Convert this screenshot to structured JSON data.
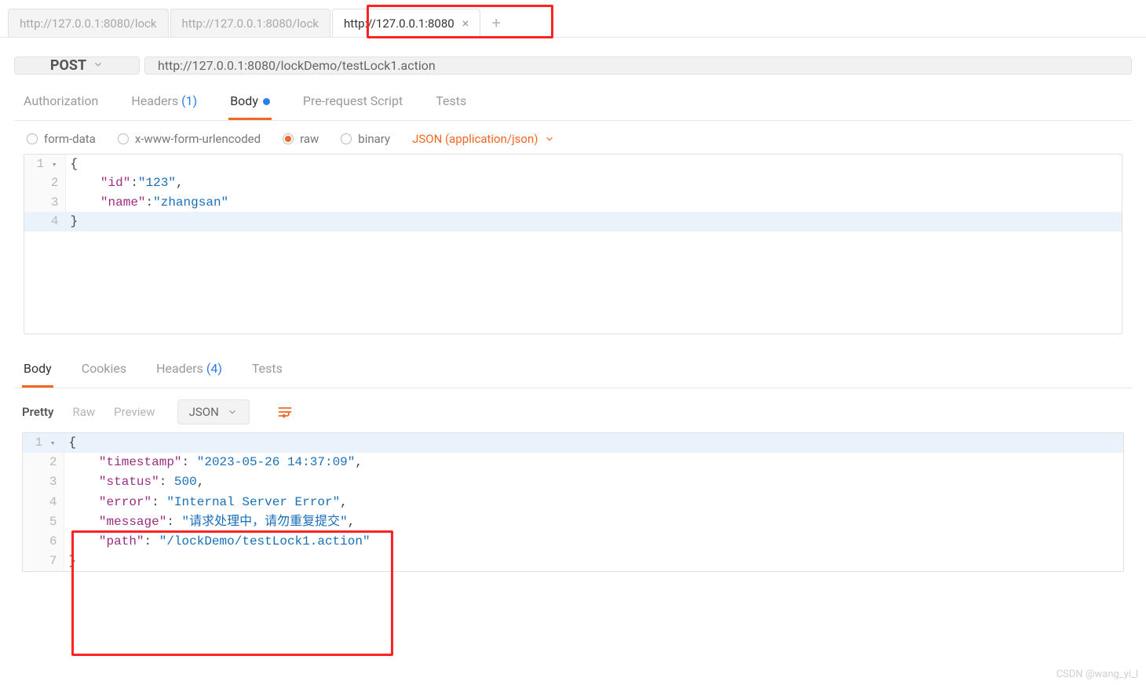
{
  "tabs": {
    "items": [
      {
        "label": "http://127.0.0.1:8080/lock"
      },
      {
        "label": "http://127.0.0.1:8080/lock"
      },
      {
        "label": "http://127.0.0.1:8080"
      }
    ]
  },
  "request": {
    "method": "POST",
    "url": "http://127.0.0.1:8080/lockDemo/testLock1.action"
  },
  "req_subtabs": {
    "authorization": "Authorization",
    "headers": "Headers",
    "headers_count": "(1)",
    "body": "Body",
    "prerequest": "Pre-request Script",
    "tests": "Tests"
  },
  "body_types": {
    "form_data": "form-data",
    "urlencoded": "x-www-form-urlencoded",
    "raw": "raw",
    "binary": "binary",
    "content_type": "JSON (application/json)"
  },
  "request_body": {
    "id_key": "\"id\"",
    "id_val": "\"123\"",
    "name_key": "\"name\"",
    "name_val": "\"zhangsan\""
  },
  "response_tabs": {
    "body": "Body",
    "cookies": "Cookies",
    "headers": "Headers",
    "headers_count": "(4)",
    "tests": "Tests"
  },
  "response_toolbar": {
    "pretty": "Pretty",
    "raw": "Raw",
    "preview": "Preview",
    "format": "JSON"
  },
  "response_body": {
    "ts_key": "\"timestamp\"",
    "ts_val": "\"2023-05-26 14:37:09\"",
    "status_key": "\"status\"",
    "status_val": "500",
    "error_key": "\"error\"",
    "error_val": "\"Internal Server Error\"",
    "message_key": "\"message\"",
    "message_val": "\"请求处理中，请勿重复提交\"",
    "path_key": "\"path\"",
    "path_val": "\"/lockDemo/testLock1.action\""
  },
  "watermark": "CSDN @wang_yi_l"
}
